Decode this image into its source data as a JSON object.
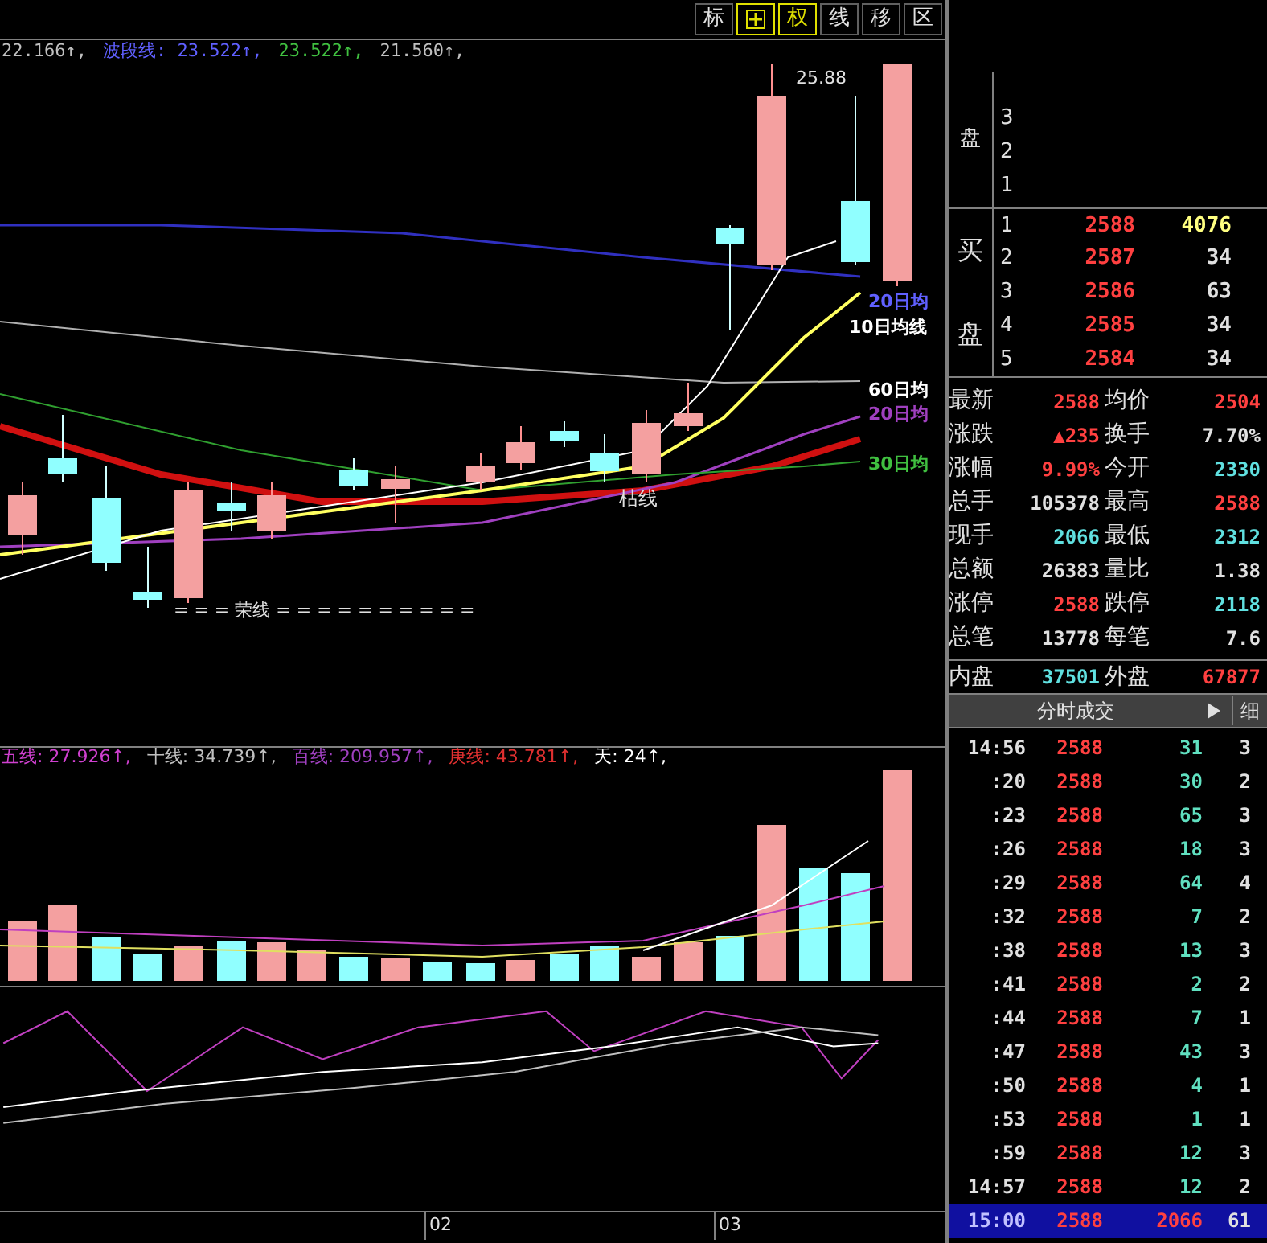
{
  "toolbar": [
    {
      "kind": "text",
      "label": "标",
      "selected": false
    },
    {
      "kind": "icon",
      "selected": true
    },
    {
      "kind": "text",
      "label": "权",
      "selected": true
    },
    {
      "kind": "text",
      "label": "线",
      "selected": false
    },
    {
      "kind": "text",
      "label": "移",
      "selected": false
    },
    {
      "kind": "text",
      "label": "区",
      "selected": false
    }
  ],
  "price_legend": [
    {
      "text": "22.166↑,",
      "color": "#c0c0c0"
    },
    {
      "text": "波段线: 23.522↑,",
      "color": "#6060ff"
    },
    {
      "text": "23.522↑,",
      "color": "#40c040"
    },
    {
      "text": "21.560↑,",
      "color": "#c0c0c0"
    }
  ],
  "chart_labels": {
    "high": "25.88",
    "dead_line": "枯线",
    "prosper_line": "= = = 荣线 = = = = = = = = = =",
    "ma_labels": [
      {
        "text": "20日均",
        "color": "#6060ff"
      },
      {
        "text": "10日均线",
        "color": "#ffffff"
      },
      {
        "text": "60日均",
        "color": "#ffffff"
      },
      {
        "text": "20日均",
        "color": "#a040c0"
      },
      {
        "text": "30日均",
        "color": "#40c040"
      }
    ]
  },
  "volume_legend": [
    {
      "text": "五线: 27.926↑,",
      "color": "#d040d0"
    },
    {
      "text": "十线: 34.739↑,",
      "color": "#c0c0c0"
    },
    {
      "text": "百线: 209.957↑,",
      "color": "#a040c0"
    },
    {
      "text": "庚线: 43.781↑,",
      "color": "#e03030"
    },
    {
      "text": "天: 24↑,",
      "color": "#ffffff"
    }
  ],
  "x_axis": [
    "02",
    "03"
  ],
  "order_book": {
    "sell_label": "盘",
    "sell": [
      {
        "level": "3"
      },
      {
        "level": "2"
      },
      {
        "level": "1"
      }
    ],
    "buy_labels": [
      "买",
      "盘"
    ],
    "buy": [
      {
        "level": "1",
        "price": "2588",
        "volume": "4076"
      },
      {
        "level": "2",
        "price": "2587",
        "volume": "34"
      },
      {
        "level": "3",
        "price": "2586",
        "volume": "63"
      },
      {
        "level": "4",
        "price": "2585",
        "volume": "34"
      },
      {
        "level": "5",
        "price": "2584",
        "volume": "34"
      }
    ]
  },
  "stats": [
    [
      {
        "label": "最新",
        "value": "2588",
        "color": "#ff4040"
      },
      {
        "label": "均价",
        "value": "2504",
        "color": "#ff4040"
      }
    ],
    [
      {
        "label": "涨跌",
        "value": "▲235",
        "color": "#ff4040"
      },
      {
        "label": "换手",
        "value": "7.70%",
        "color": "#e0e0e0"
      }
    ],
    [
      {
        "label": "涨幅",
        "value": "9.99%",
        "color": "#ff4040"
      },
      {
        "label": "今开",
        "value": "2330",
        "color": "#60e0e0"
      }
    ],
    [
      {
        "label": "总手",
        "value": "105378",
        "color": "#e0e0e0"
      },
      {
        "label": "最高",
        "value": "2588",
        "color": "#ff4040"
      }
    ],
    [
      {
        "label": "现手",
        "value": "2066",
        "color": "#60e0e0"
      },
      {
        "label": "最低",
        "value": "2312",
        "color": "#60e0e0"
      }
    ],
    [
      {
        "label": "总额",
        "value": "26383",
        "color": "#e0e0e0"
      },
      {
        "label": "量比",
        "value": "1.38",
        "color": "#e0e0e0"
      }
    ],
    [
      {
        "label": "涨停",
        "value": "2588",
        "color": "#ff4040"
      },
      {
        "label": "跌停",
        "value": "2118",
        "color": "#60e0e0"
      }
    ],
    [
      {
        "label": "总笔",
        "value": "13778",
        "color": "#e0e0e0"
      },
      {
        "label": "每笔",
        "value": "7.6",
        "color": "#e0e0e0"
      }
    ],
    [
      {
        "label": "内盘",
        "value": "37501",
        "color": "#60e0e0"
      },
      {
        "label": "外盘",
        "value": "67877",
        "color": "#ff4040"
      }
    ]
  ],
  "ticks": {
    "title": "分时成交",
    "detail_button": "细",
    "rows": [
      {
        "time": "14:56",
        "price": "2588",
        "volume": "31",
        "count": "3",
        "selected": false
      },
      {
        "time": ":20",
        "price": "2588",
        "volume": "30",
        "count": "2",
        "selected": false
      },
      {
        "time": ":23",
        "price": "2588",
        "volume": "65",
        "count": "3",
        "selected": false
      },
      {
        "time": ":26",
        "price": "2588",
        "volume": "18",
        "count": "3",
        "selected": false
      },
      {
        "time": ":29",
        "price": "2588",
        "volume": "64",
        "count": "4",
        "selected": false
      },
      {
        "time": ":32",
        "price": "2588",
        "volume": "7",
        "count": "2",
        "selected": false
      },
      {
        "time": ":38",
        "price": "2588",
        "volume": "13",
        "count": "3",
        "selected": false
      },
      {
        "time": ":41",
        "price": "2588",
        "volume": "2",
        "count": "2",
        "selected": false
      },
      {
        "time": ":44",
        "price": "2588",
        "volume": "7",
        "count": "1",
        "selected": false
      },
      {
        "time": ":47",
        "price": "2588",
        "volume": "43",
        "count": "3",
        "selected": false
      },
      {
        "time": ":50",
        "price": "2588",
        "volume": "4",
        "count": "1",
        "selected": false
      },
      {
        "time": ":53",
        "price": "2588",
        "volume": "1",
        "count": "1",
        "selected": false
      },
      {
        "time": ":59",
        "price": "2588",
        "volume": "12",
        "count": "3",
        "selected": false
      },
      {
        "time": "14:57",
        "price": "2588",
        "volume": "12",
        "count": "2",
        "selected": false
      },
      {
        "time": "15:00",
        "price": "2588",
        "volume": "2066",
        "count": "61",
        "selected": true
      }
    ]
  }
}
